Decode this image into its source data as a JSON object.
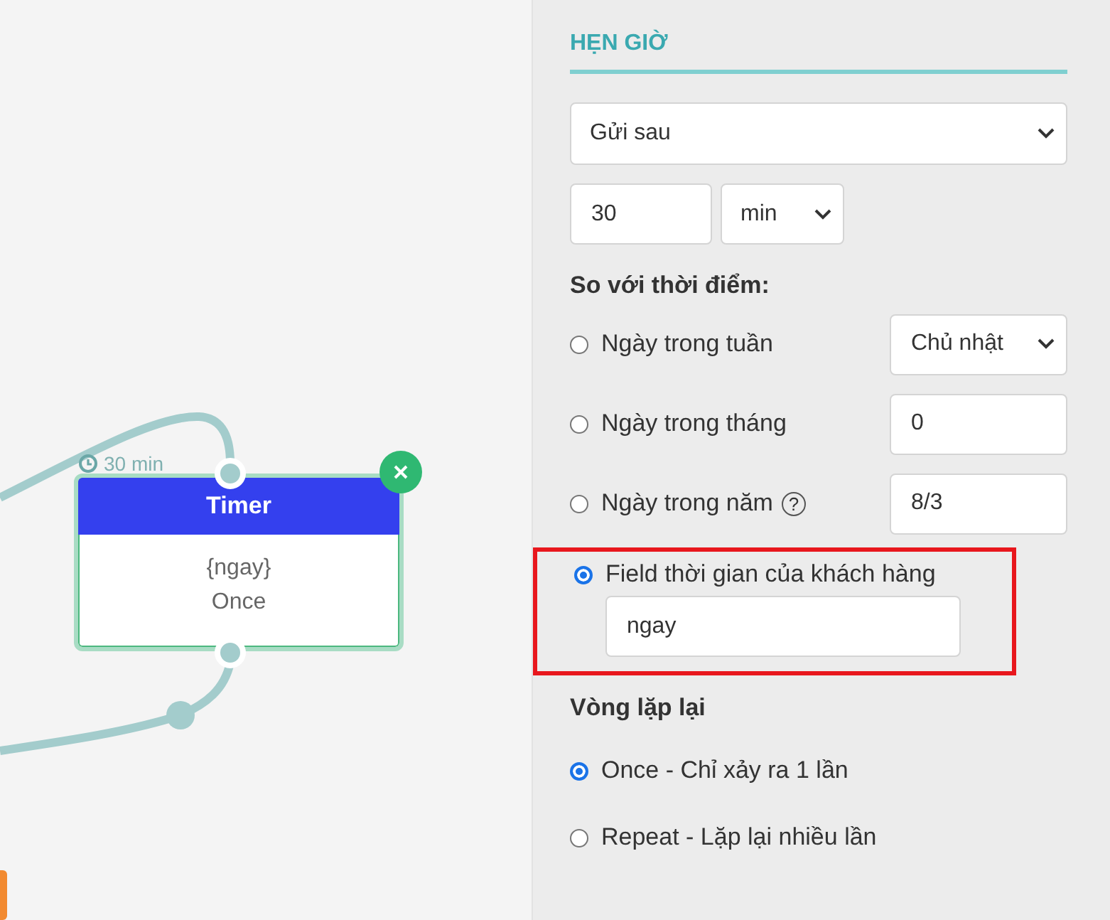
{
  "canvas": {
    "node": {
      "title": "Timer",
      "delay": "30 min",
      "lines": [
        "{ngay}",
        "Once"
      ]
    }
  },
  "panel": {
    "title": "HẸN GIỜ",
    "mode_select": "Gửi sau",
    "delay_value": "30",
    "delay_unit": "min",
    "reference_heading": "So với thời điểm:",
    "reference_options": [
      {
        "label": "Ngày trong tuần",
        "selected": false,
        "kind": "select",
        "value": "Chủ nhật"
      },
      {
        "label": "Ngày trong tháng",
        "selected": false,
        "kind": "input",
        "value": "0"
      },
      {
        "label": "Ngày trong năm",
        "help": "?",
        "selected": false,
        "kind": "input",
        "value": "8/3"
      },
      {
        "label": "Field thời gian của khách hàng",
        "selected": true,
        "kind": "field",
        "value": "ngay",
        "highlighted": true
      }
    ],
    "repeat_heading": "Vòng lặp lại",
    "repeat_options": [
      {
        "label": "Once - Chỉ xảy ra 1 lần",
        "selected": true
      },
      {
        "label": "Repeat - Lặp lại nhiều lần",
        "selected": false
      }
    ]
  }
}
